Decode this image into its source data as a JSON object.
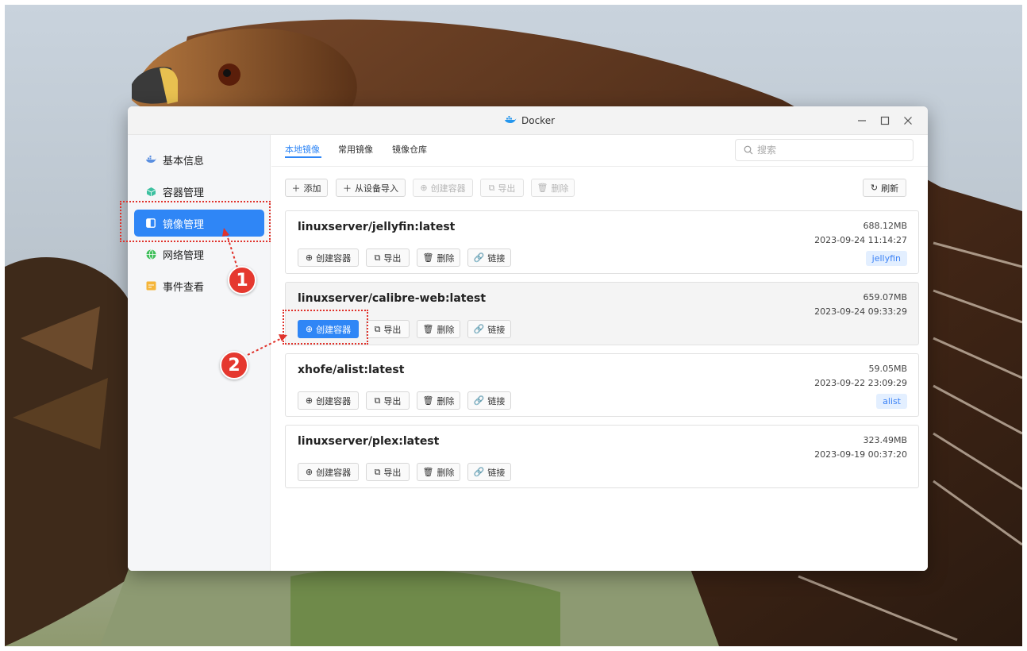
{
  "window": {
    "title": "Docker"
  },
  "sidebar": {
    "items": [
      {
        "label": "基本信息",
        "icon": "docker-whale-icon",
        "active": false
      },
      {
        "label": "容器管理",
        "icon": "cube-icon",
        "active": false
      },
      {
        "label": "镜像管理",
        "icon": "image-layers-icon",
        "active": true
      },
      {
        "label": "网络管理",
        "icon": "globe-icon",
        "active": false
      },
      {
        "label": "事件查看",
        "icon": "event-log-icon",
        "active": false
      }
    ]
  },
  "tabs": [
    {
      "label": "本地镜像",
      "active": true
    },
    {
      "label": "常用镜像",
      "active": false
    },
    {
      "label": "镜像仓库",
      "active": false
    }
  ],
  "search": {
    "placeholder": "搜索"
  },
  "toolbar": {
    "add": "添加",
    "import": "从设备导入",
    "create": "创建容器",
    "export": "导出",
    "delete": "删除",
    "refresh": "刷新"
  },
  "images": [
    {
      "name": "linuxserver/jellyfin:latest",
      "size": "688.12MB",
      "date": "2023-09-24 11:14:27",
      "tag": "jellyfin"
    },
    {
      "name": "linuxserver/calibre-web:latest",
      "size": "659.07MB",
      "date": "2023-09-24 09:33:29",
      "tag": ""
    },
    {
      "name": "xhofe/alist:latest",
      "size": "59.05MB",
      "date": "2023-09-22 23:09:29",
      "tag": "alist"
    },
    {
      "name": "linuxserver/plex:latest",
      "size": "323.49MB",
      "date": "2023-09-19 00:37:20",
      "tag": ""
    }
  ],
  "card_actions": {
    "create": "创建容器",
    "export": "导出",
    "delete": "删除",
    "link": "链接"
  },
  "annotations": {
    "step1": "1",
    "step2": "2"
  },
  "colors": {
    "accent": "#2f86f6",
    "annotation": "#e5382f",
    "tag_bg": "#e3efff"
  }
}
